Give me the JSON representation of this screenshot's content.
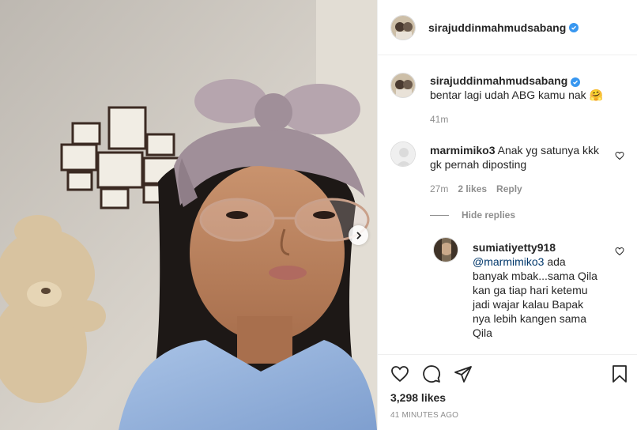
{
  "post": {
    "username": "sirajuddinmahmudsabang",
    "verified": true
  },
  "caption": {
    "username": "sirajuddinmahmudsabang",
    "text": "bentar lagi udah ABG kamu nak 🤗",
    "time": "41m"
  },
  "comments": [
    {
      "username": "marmimiko3",
      "text": "Anak yg satunya kkk gk pernah diposting",
      "time": "27m",
      "likes": "2 likes",
      "reply_label": "Reply"
    }
  ],
  "hide_replies_label": "Hide replies",
  "replies": [
    {
      "username": "sumiatiyetty918",
      "mention": "@marmimiko3",
      "text": "ada banyak mbak...sama Qila kan ga tiap hari ketemu jadi wajar kalau Bapak nya lebih kangen sama Qila"
    }
  ],
  "actions": {
    "like_icon": "heart-icon",
    "comment_icon": "comment-bubble-icon",
    "share_icon": "paper-plane-icon",
    "save_icon": "bookmark-icon"
  },
  "likes_count": "3,298 likes",
  "timestamp": "41 MINUTES AGO",
  "colors": {
    "verified": "#3897f0",
    "link": "#00376b",
    "muted": "#8e8e8e",
    "text": "#262626"
  }
}
